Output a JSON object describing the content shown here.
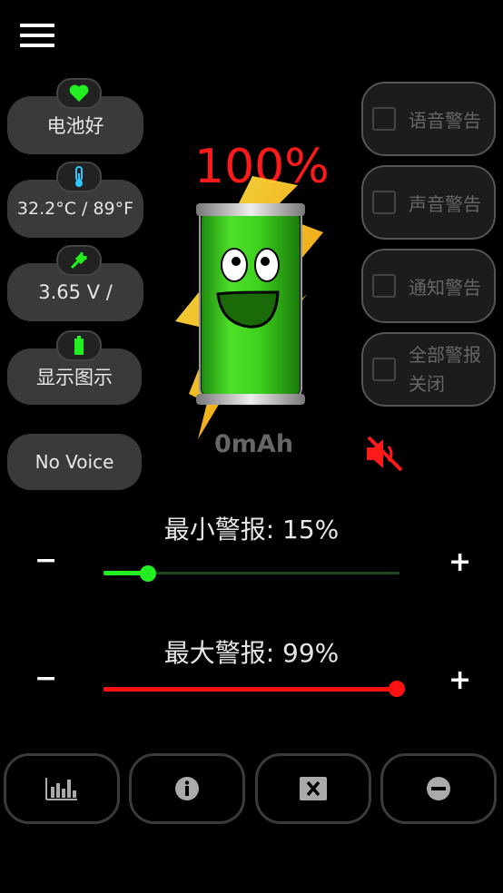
{
  "left_panel": {
    "health": {
      "label": "电池好",
      "icon": "heart-icon"
    },
    "temperature": {
      "label": "32.2°C / 89°F",
      "icon": "thermometer-icon"
    },
    "voltage": {
      "label": "3.65 V /",
      "icon": "plug-icon"
    },
    "display": {
      "label": "显示图示",
      "icon": "battery-icon"
    },
    "voice": {
      "label": "No Voice"
    }
  },
  "battery": {
    "percent_text": "100%",
    "level": 1.0,
    "capacity_text": "0mAh"
  },
  "right_panel": {
    "voice_alert": "语音警告",
    "sound_alert": "声音警告",
    "notify_alert": "通知警告",
    "all_off_line1": "全部警报",
    "all_off_line2": "关闭"
  },
  "sliders": {
    "min": {
      "label": "最小警报: 15%",
      "value": 0.15,
      "minus": "−",
      "plus": "+",
      "color": "#22ee22"
    },
    "max": {
      "label": "最大警报: 99%",
      "value": 0.99,
      "minus": "−",
      "plus": "+",
      "color": "#ff1111"
    }
  },
  "bottom_bar": [
    {
      "icon": "bar-chart-icon"
    },
    {
      "icon": "info-icon"
    },
    {
      "icon": "close-box-icon"
    },
    {
      "icon": "minus-circle-icon"
    }
  ],
  "colors": {
    "percent": "#ff1a1a",
    "accent_green": "#22ee22",
    "mute": "#ff1a1a"
  }
}
